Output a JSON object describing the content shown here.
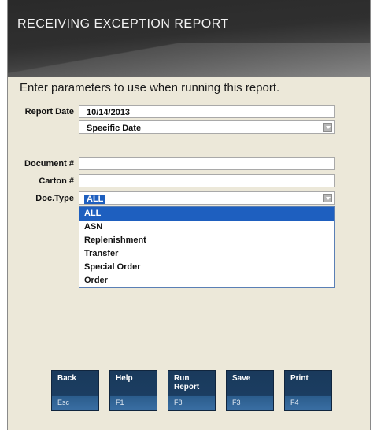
{
  "header": {
    "title": "RECEIVING EXCEPTION REPORT"
  },
  "intro": "Enter parameters to use when running this report.",
  "form": {
    "report_date_label": "Report Date",
    "report_date_value": "10/14/2013",
    "date_mode_value": "Specific Date",
    "document_label": "Document #",
    "document_value": "",
    "carton_label": "Carton #",
    "carton_value": "",
    "doctype_label": "Doc.Type",
    "doctype_value": "ALL",
    "doctype_options": [
      "ALL",
      "ASN",
      "Replenishment",
      "Transfer",
      "Special Order",
      "Order"
    ]
  },
  "buttons": [
    {
      "label": "Back",
      "key": "Esc"
    },
    {
      "label": "Help",
      "key": "F1"
    },
    {
      "label": "Run Report",
      "key": "F8"
    },
    {
      "label": "Save",
      "key": "F3"
    },
    {
      "label": "Print",
      "key": "F4"
    }
  ],
  "colors": {
    "selection": "#1e5fbf",
    "button": "#1b3d61",
    "panel": "#ece8d9",
    "header": "#2f2f2f"
  }
}
